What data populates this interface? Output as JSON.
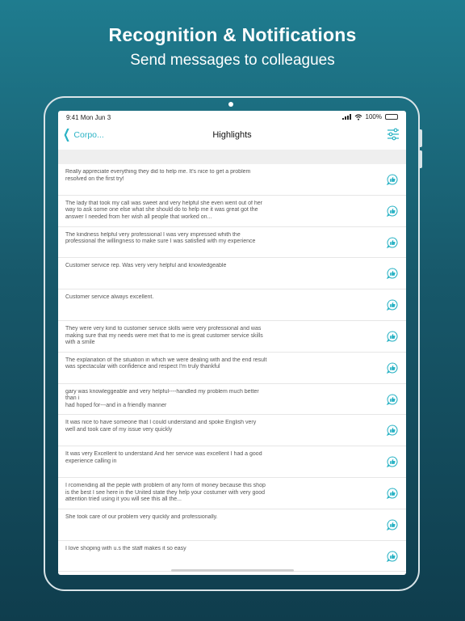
{
  "marketing": {
    "headline": "Recognition & Notifications",
    "subheadline": "Send messages to colleagues"
  },
  "status_bar": {
    "time": "9:41 Mon Jun 3",
    "battery": "100%"
  },
  "nav": {
    "back_label": "Corpo...",
    "title": "Highlights"
  },
  "colors": {
    "accent": "#2bb3c5",
    "background_top": "#1f7c8f",
    "background_bottom": "#0f3d4d"
  },
  "highlights": [
    {
      "text": "Really appreciate everything they did to help me. It's nice to get a problem resolved on the first try!",
      "icon": "thumbs-up-bubble-icon"
    },
    {
      "text": "The lady that took my call was sweet and very helpful she even went out of her way to ask some one else what she should do to help me it was great got the answer I needed from her wish all people that worked on...",
      "icon": "thumbs-up-bubble-icon"
    },
    {
      "text": "The kindness helpful very professional  I was very impressed whith the professional  the willingness to make sure I was satisfied with my experience",
      "icon": "thumbs-up-bubble-icon"
    },
    {
      "text": "Customer service rep. Was very very helpful and knowledgeable",
      "icon": "thumbs-up-bubble-icon"
    },
    {
      "text": "Customer service always excellent.",
      "icon": "thumbs-up-bubble-icon"
    },
    {
      "text": "They were very kind to customer service skills were very professional and was making sure that my needs were met that to me is great customer service skills with a smile",
      "icon": "thumbs-up-bubble-icon"
    },
    {
      "text": "The explanation of the situation in which we were dealing with and the end result was spectacular with confidence and respect I'm truly thankful",
      "icon": "thumbs-up-bubble-icon"
    },
    {
      "text": "gary was knowleggeable and very helpful----handled my problem much better than i\nhad hoped for---and in a friendly manner",
      "icon": "thumbs-up-bubble-icon"
    },
    {
      "text": "It was nice to have someone that I could understand and spoke English very well and took care of my issue very quickly",
      "icon": "thumbs-up-bubble-icon"
    },
    {
      "text": "It was very  Excellent  to understand And her service was excellent I had a good experience   calling in",
      "icon": "thumbs-up-bubble-icon"
    },
    {
      "text": "I rcomending all the peple with problem of any form of money because this shop is the best I see here in the United state they help your costumer with very good attention tried using it you will see this all the...",
      "icon": "thumbs-up-bubble-icon"
    },
    {
      "text": "She took care of our problem very quickly and professionally.",
      "icon": "thumbs-up-bubble-icon"
    },
    {
      "text": "I love shoping with u.s the staff makes it so easy",
      "icon": "thumbs-up-bubble-icon"
    }
  ]
}
